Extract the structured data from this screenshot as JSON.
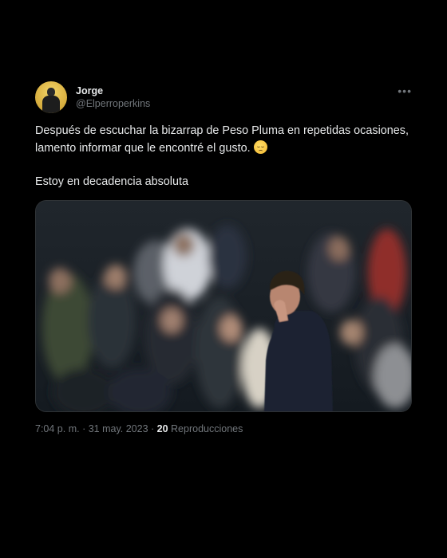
{
  "author": {
    "display_name": "Jorge",
    "handle": "@Elperroperkins",
    "avatar_icon": "avatar-photo"
  },
  "more_icon": "more-options-icon",
  "tweet": {
    "line1": "Después de escuchar la bizarrap de Peso Pluma en repetidas ocasiones,",
    "line2": "lamento informar que le encontré el gusto.",
    "emoji": "relieved-face-emoji",
    "line3": "Estoy en decadencia absoluta"
  },
  "media": {
    "description_icon": "photo-man-covering-face-in-stadium"
  },
  "meta": {
    "time": "7:04 p. m.",
    "separator": " · ",
    "date": "31 may. 2023",
    "views_count": "20",
    "views_label": "Reproducciones"
  },
  "colors": {
    "background": "#000000",
    "text_primary": "#e7e9ea",
    "text_secondary": "#71767b"
  }
}
